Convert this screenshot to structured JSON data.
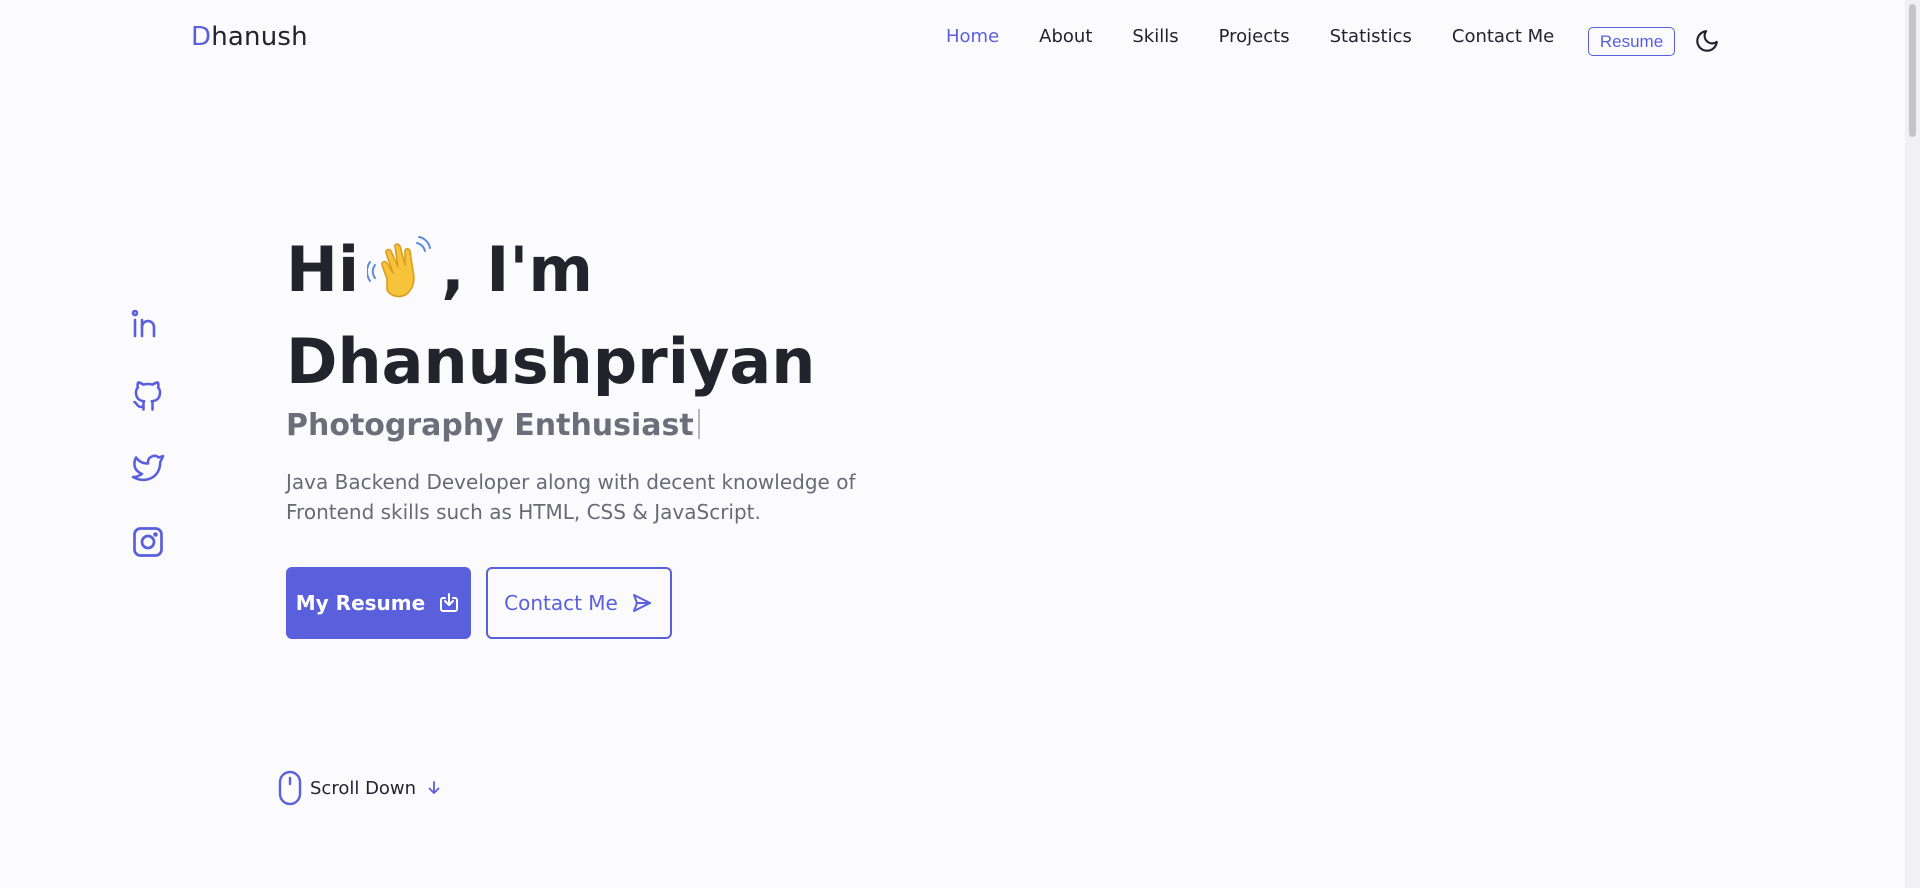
{
  "header": {
    "logo_first": "D",
    "logo_rest": "hanush",
    "nav": [
      {
        "label": "Home",
        "active": true
      },
      {
        "label": "About"
      },
      {
        "label": "Skills"
      },
      {
        "label": "Projects"
      },
      {
        "label": "Statistics"
      },
      {
        "label": "Contact Me"
      }
    ],
    "resume_label": "Resume",
    "theme_icon": "moon-icon"
  },
  "socials": [
    "linkedin-icon",
    "github-icon",
    "twitter-icon",
    "instagram-icon"
  ],
  "hero": {
    "greeting_hi": "Hi",
    "greeting_rest": ", I'm",
    "name": "Dhanushpriyan",
    "subtitle": "Photography Enthusiast",
    "description": "Java Backend Developer along with decent knowledge of Frontend skills such as HTML, CSS & JavaScript.",
    "primary_button": "My Resume",
    "secondary_button": "Contact Me",
    "scroll_label": "Scroll Down"
  },
  "colors": {
    "accent": "#5a5fdc",
    "text": "#23232b",
    "muted": "#6e6e7a",
    "background": "#fbfbfd"
  }
}
